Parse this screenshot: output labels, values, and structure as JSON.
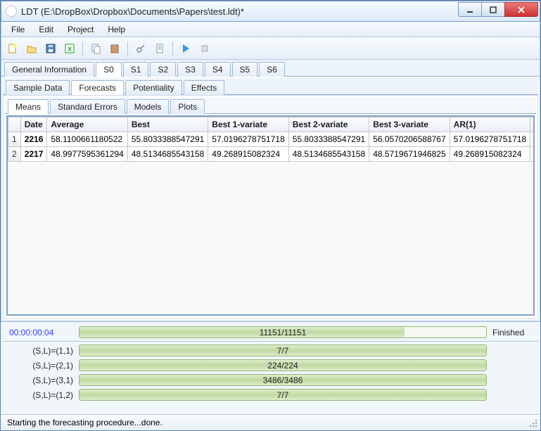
{
  "window": {
    "title": "LDT (E:\\DropBox\\Dropbox\\Documents\\Papers\\test.ldt)*"
  },
  "menu": {
    "file": "File",
    "edit": "Edit",
    "project": "Project",
    "help": "Help"
  },
  "outer_tabs": [
    "General Information",
    "S0",
    "S1",
    "S2",
    "S3",
    "S4",
    "S5",
    "S6"
  ],
  "outer_tabs_active": 1,
  "mid_tabs": [
    "Sample Data",
    "Forecasts",
    "Potentiality",
    "Effects"
  ],
  "mid_tabs_active": 1,
  "inner_tabs": [
    "Means",
    "Standard Errors",
    "Models",
    "Plots"
  ],
  "inner_tabs_active": 0,
  "table": {
    "columns": [
      "Date",
      "Average",
      "Best",
      "Best 1-variate",
      "Best 2-variate",
      "Best 3-variate",
      "AR(1)"
    ],
    "rows": [
      {
        "n": "1",
        "date": "2216",
        "cells": [
          "58.1100661180522",
          "55.8033388547291",
          "57.0196278751718",
          "55.8033388547291",
          "56.0570206588767",
          "57.0196278751718"
        ]
      },
      {
        "n": "2",
        "date": "2217",
        "cells": [
          "48.9977595361294",
          "48.5134685543158",
          "49.268915082324",
          "48.5134685543158",
          "48.5719671946825",
          "49.268915082324"
        ]
      }
    ]
  },
  "progress": {
    "timer": "00:00:00:04",
    "main": {
      "text": "11151/11151",
      "pct": 80,
      "right": "Finished"
    },
    "subs": [
      {
        "label": "(S,L)=(1,1)",
        "text": "7/7",
        "pct": 100
      },
      {
        "label": "(S,L)=(2,1)",
        "text": "224/224",
        "pct": 100
      },
      {
        "label": "(S,L)=(3,1)",
        "text": "3486/3486",
        "pct": 100
      },
      {
        "label": "(S,L)=(1,2)",
        "text": "7/7",
        "pct": 100
      }
    ]
  },
  "status": "Starting the forecasting procedure...done."
}
